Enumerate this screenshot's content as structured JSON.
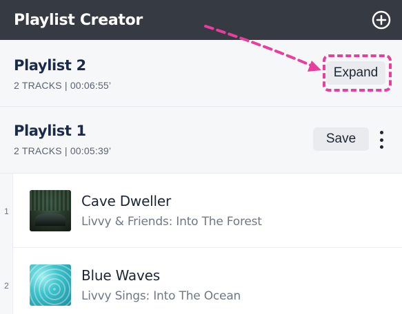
{
  "app": {
    "title": "Playlist Creator",
    "add_icon": "plus-circle-icon"
  },
  "playlists": [
    {
      "name": "Playlist 2",
      "meta": "2 TRACKS | 00:06:55’",
      "action_label": "Expand"
    },
    {
      "name": "Playlist 1",
      "meta": "2 TRACKS | 00:05:39’",
      "action_label": "Save",
      "menu_icon": "more-vertical-icon"
    }
  ],
  "tracks": [
    {
      "number": "1",
      "title": "Cave Dweller",
      "subtitle": "Livvy & Friends: Into The Forest",
      "art": "forest-cave-artwork"
    },
    {
      "number": "2",
      "title": "Blue Waves",
      "subtitle": "Livvy Sings: Into The Ocean",
      "art": "ocean-water-artwork"
    }
  ],
  "annotation": {
    "color": "#e83e9c",
    "target": "Expand"
  },
  "colors": {
    "header_bg": "#363a42",
    "accent": "#e83e9c",
    "playlist_bg": "#f6f7f9",
    "button_bg": "#e9ebef"
  }
}
